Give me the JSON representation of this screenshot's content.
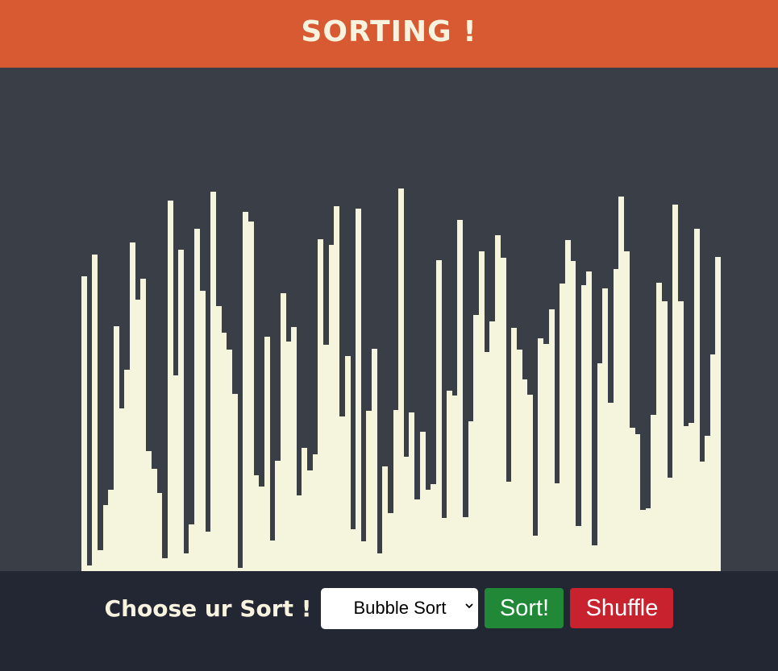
{
  "header": {
    "title": "SORTING !"
  },
  "colors": {
    "header_bg": "#d75a33",
    "stage_bg": "#393e47",
    "bar": "#f5f5dd",
    "footer_bg": "#222733",
    "sort_button": "#218838",
    "shuffle_button": "#c8222f"
  },
  "bars": {
    "max_value": 475,
    "values": [
      366,
      7,
      393,
      26,
      82,
      101,
      304,
      202,
      250,
      408,
      337,
      363,
      149,
      127,
      97,
      16,
      460,
      243,
      399,
      22,
      58,
      425,
      348,
      49,
      471,
      329,
      296,
      275,
      220,
      4,
      446,
      434,
      119,
      105,
      291,
      38,
      137,
      345,
      285,
      303,
      94,
      153,
      125,
      145,
      412,
      281,
      405,
      453,
      192,
      267,
      52,
      450,
      37,
      199,
      276,
      22,
      130,
      72,
      200,
      475,
      142,
      197,
      89,
      173,
      101,
      108,
      386,
      66,
      224,
      218,
      436,
      67,
      186,
      318,
      397,
      272,
      310,
      417,
      389,
      111,
      302,
      275,
      238,
      219,
      44,
      289,
      282,
      325,
      109,
      357,
      411,
      385,
      56,
      355,
      372,
      32,
      258,
      351,
      209,
      375,
      465,
      397,
      178,
      170,
      76,
      78,
      194,
      358,
      335,
      116,
      455,
      335,
      180,
      184,
      425,
      136,
      168,
      269,
      390
    ],
    "chart_data": {
      "type": "bar",
      "values": [
        366,
        7,
        393,
        26,
        82,
        101,
        304,
        202,
        250,
        408,
        337,
        363,
        149,
        127,
        97,
        16,
        460,
        243,
        399,
        22,
        58,
        425,
        348,
        49,
        471,
        329,
        296,
        275,
        220,
        4,
        446,
        434,
        119,
        105,
        291,
        38,
        137,
        345,
        285,
        303,
        94,
        153,
        125,
        145,
        412,
        281,
        405,
        453,
        192,
        267,
        52,
        450,
        37,
        199,
        276,
        22,
        130,
        72,
        200,
        475,
        142,
        197,
        89,
        173,
        101,
        108,
        386,
        66,
        224,
        218,
        436,
        67,
        186,
        318,
        397,
        272,
        310,
        417,
        389,
        111,
        302,
        275,
        238,
        219,
        44,
        289,
        282,
        325,
        109,
        357,
        411,
        385,
        56,
        355,
        372,
        32,
        258,
        351,
        209,
        375,
        465,
        397,
        178,
        170,
        76,
        78,
        194,
        358,
        335,
        116,
        455,
        335,
        180,
        184,
        425,
        136,
        168,
        269,
        390
      ]
    }
  },
  "footer": {
    "choose_label": "Choose ur Sort !",
    "select": {
      "selected": "Bubble Sort"
    },
    "sort_label": "Sort!",
    "shuffle_label": "Shuffle"
  }
}
